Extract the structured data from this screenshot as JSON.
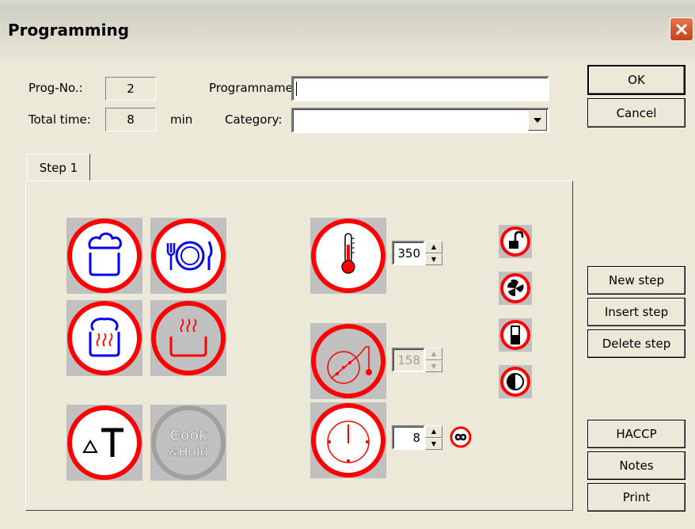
{
  "window": {
    "title": "Programming"
  },
  "form": {
    "prog_no_label": "Prog-No.:",
    "prog_no_value": "2",
    "total_time_label": "Total time:",
    "total_time_value": "8",
    "total_time_unit": "min",
    "programname_label": "Programname:",
    "programname_value": "",
    "category_label": "Category:",
    "category_value": ""
  },
  "buttons": {
    "ok": "OK",
    "cancel": "Cancel",
    "new_step": "New step",
    "insert_step": "Insert step",
    "delete_step": "Delete step",
    "haccp": "HACCP",
    "notes": "Notes",
    "print": "Print"
  },
  "tabs": [
    {
      "label": "Step 1"
    }
  ],
  "step": {
    "temperature_value": "350",
    "core_temp_value": "158",
    "time_value": "8",
    "cook_hold_text": [
      "Cook",
      "&Hold"
    ]
  },
  "icons": [
    "pot-icon",
    "plate-icon",
    "toast-icon",
    "steam-pot-icon",
    "delta-t-icon",
    "cook-hold-icon",
    "thermometer-icon",
    "core-probe-icon",
    "clock-icon",
    "infinity-icon",
    "lock-icon",
    "fan-icon",
    "half-power-icon",
    "half-circle-icon",
    "close-icon",
    "dropdown-arrow-icon"
  ],
  "colors": {
    "ring_red": "#ff0000",
    "icon_blue": "#0000ff",
    "icon_box_gray": "#c0c0c0",
    "dialog_bg": "#ece9d8"
  }
}
